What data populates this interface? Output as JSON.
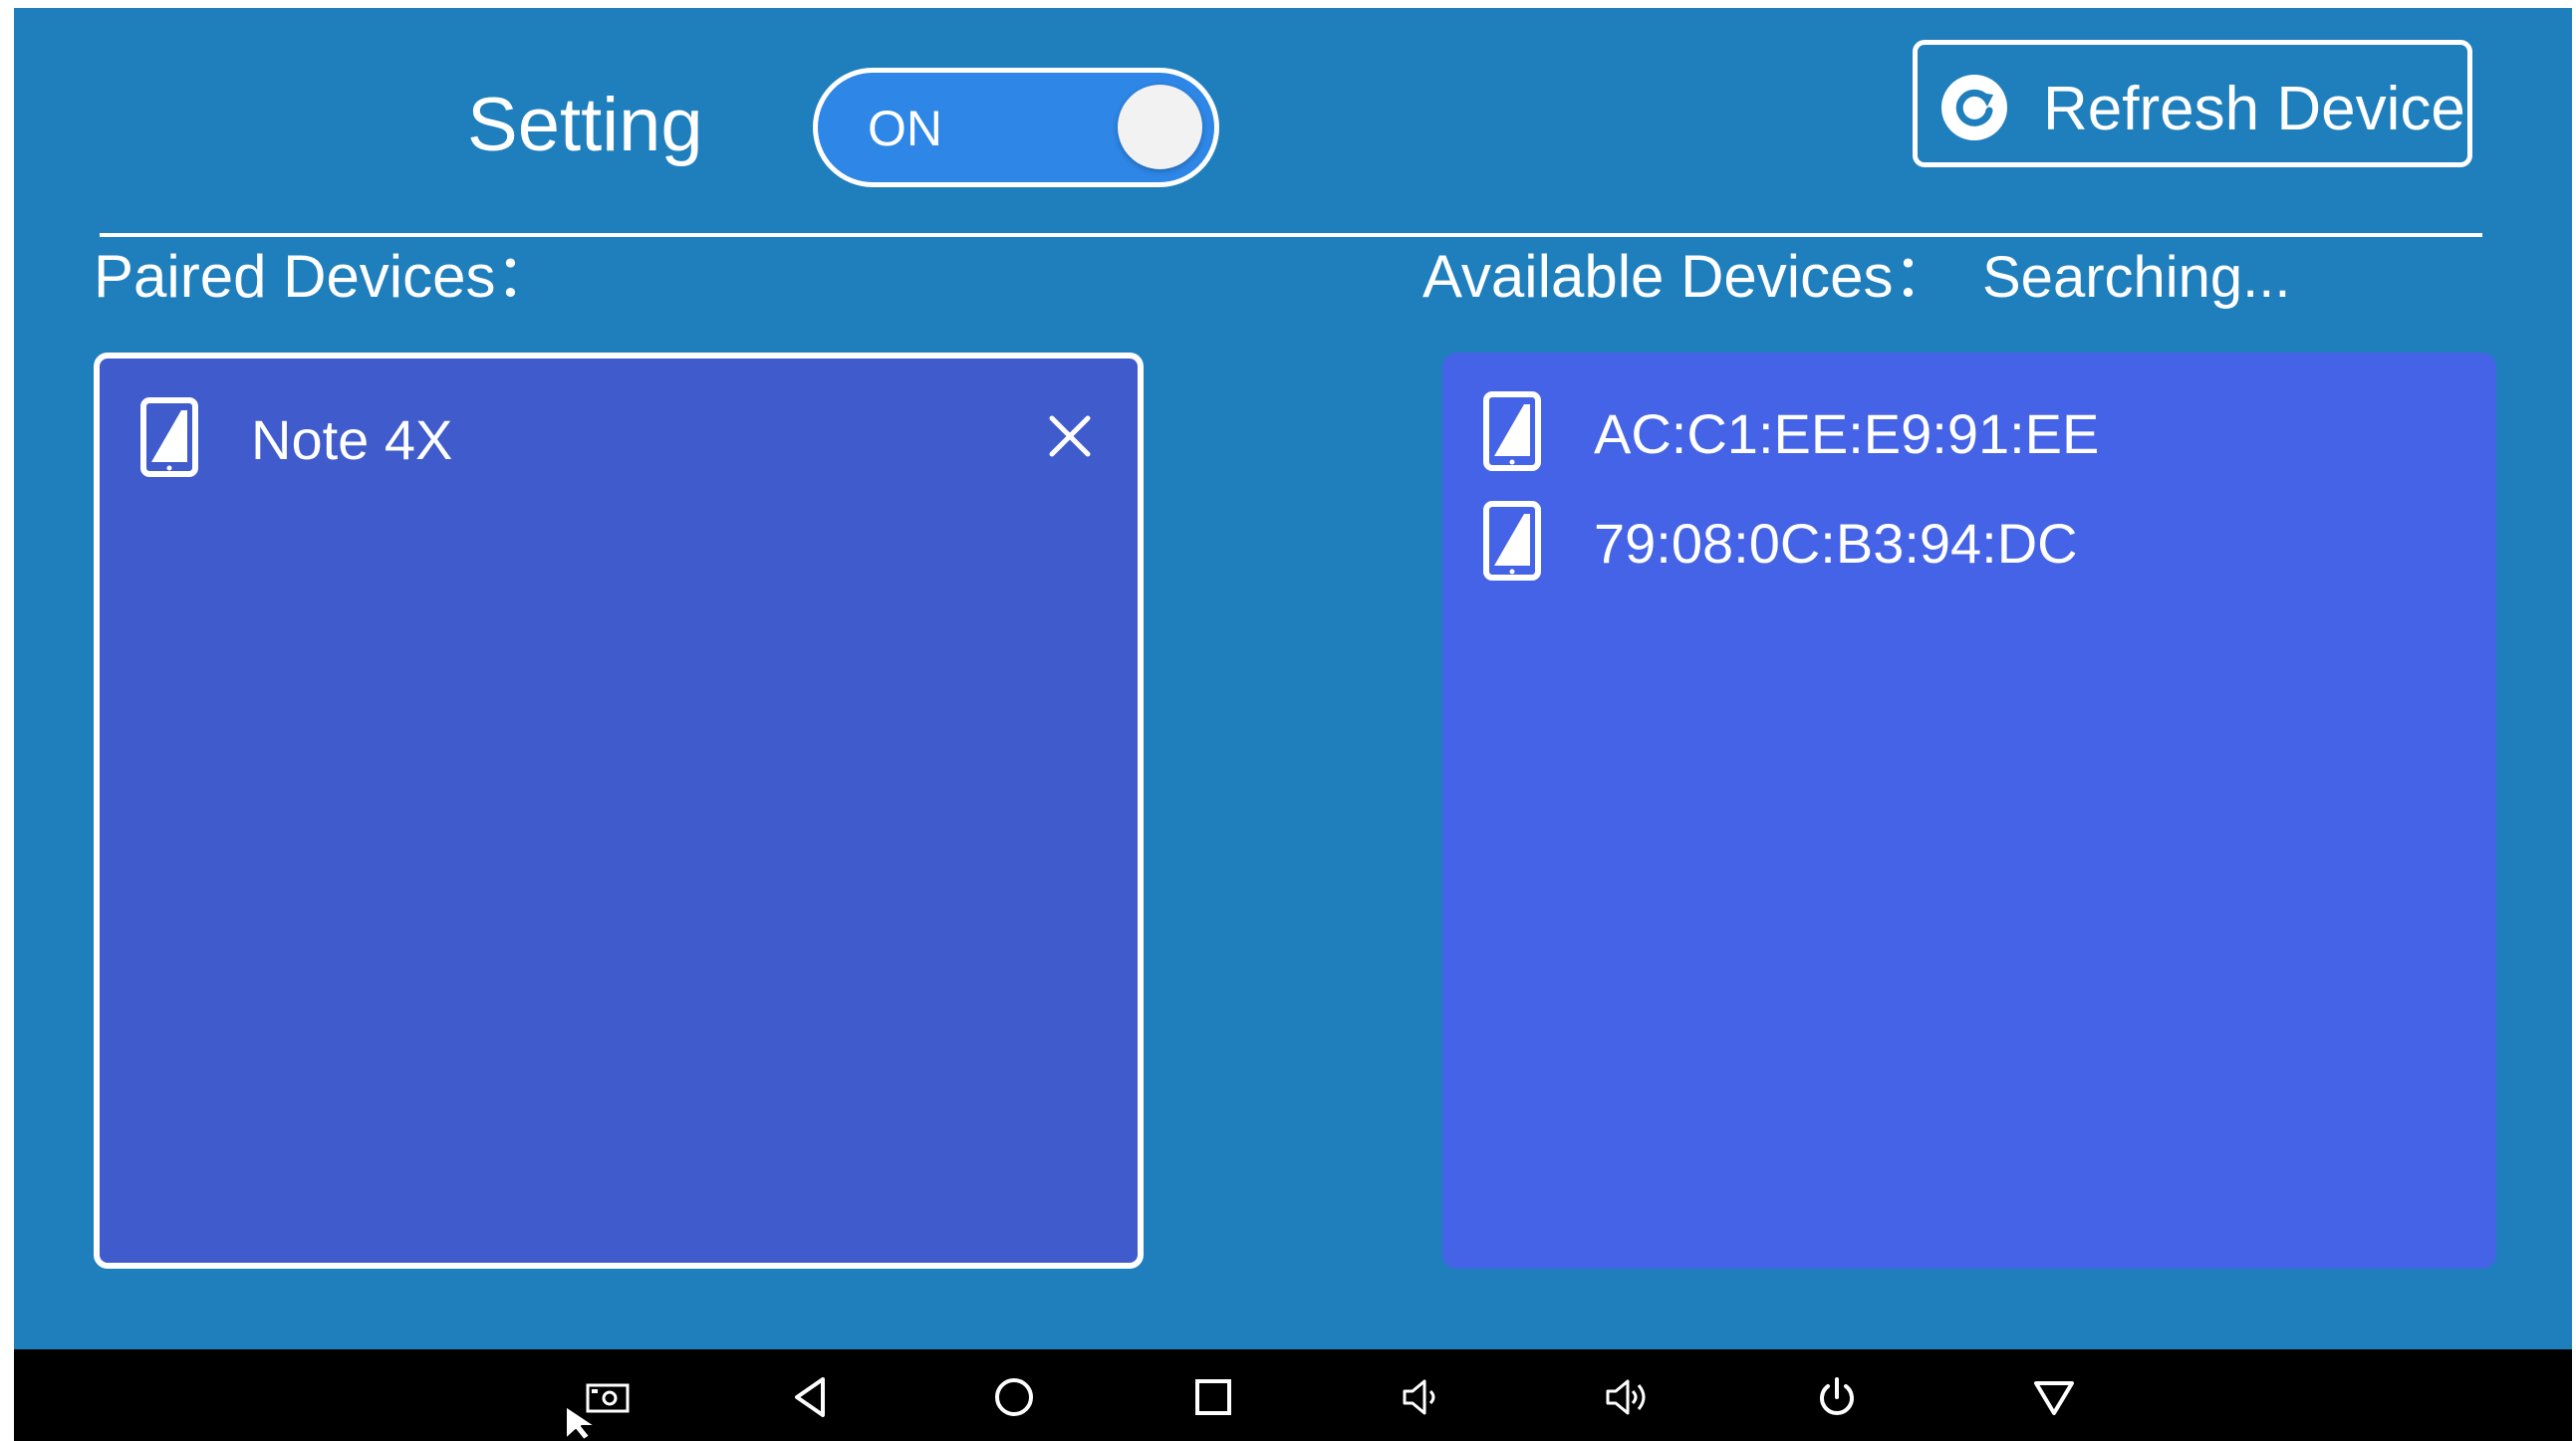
{
  "header": {
    "title": "Setting",
    "toggle_label": "ON",
    "toggle_state": "on",
    "refresh_label": "Refresh Device"
  },
  "paired": {
    "label": "Paired Devices：",
    "devices": [
      {
        "name": "Note 4X"
      }
    ]
  },
  "available": {
    "label": "Available Devices：",
    "status": "Searching...",
    "devices": [
      {
        "name": "AC:C1:EE:E9:91:EE"
      },
      {
        "name": "79:08:0C:B3:94:DC"
      }
    ]
  },
  "navbar": {
    "icons": [
      "screenshot-icon",
      "back-icon",
      "home-icon",
      "recents-icon",
      "volume-down-icon",
      "volume-up-icon",
      "power-icon",
      "hide-navbar-icon"
    ]
  },
  "colors": {
    "background": "#1f7fbd",
    "paired_panel": "#3f5bcc",
    "available_panel": "#4563e6",
    "toggle": "#2e86e6",
    "navbar": "#000000"
  }
}
